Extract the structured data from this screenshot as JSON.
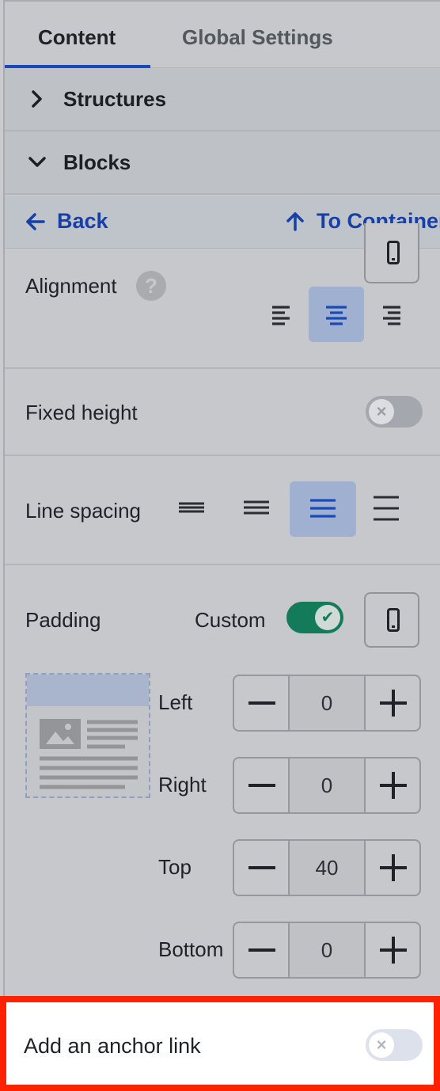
{
  "tabs": [
    {
      "label": "Content",
      "active": true
    },
    {
      "label": "Global Settings",
      "active": false
    }
  ],
  "sections": {
    "structures": "Structures",
    "blocks": "Blocks"
  },
  "nav": {
    "back": "Back",
    "to_container": "To Container"
  },
  "alignment": {
    "label": "Alignment",
    "help": "?",
    "options": [
      "left",
      "center",
      "right"
    ],
    "selected": "center"
  },
  "fixed_height": {
    "label": "Fixed height",
    "enabled": false
  },
  "line_spacing": {
    "label": "Line spacing",
    "options": [
      "compact",
      "normal",
      "relaxed",
      "wide"
    ],
    "selected": "relaxed"
  },
  "padding": {
    "label": "Padding",
    "custom_label": "Custom",
    "custom_enabled": true,
    "fields": [
      {
        "label": "Left",
        "value": "0"
      },
      {
        "label": "Right",
        "value": "0"
      },
      {
        "label": "Top",
        "value": "40"
      },
      {
        "label": "Bottom",
        "value": "0"
      }
    ]
  },
  "anchor": {
    "label": "Add an anchor link",
    "enabled": false
  },
  "colors": {
    "accent": "#1a49b8",
    "toggle_on": "#137a5a",
    "highlight_border": "#ff2200"
  }
}
